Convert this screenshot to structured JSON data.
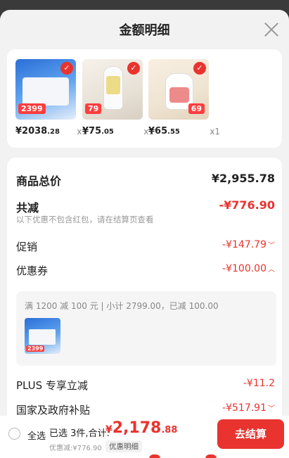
{
  "sheet": {
    "title": "金额明细"
  },
  "products": [
    {
      "price_int": "¥2038",
      "price_dec": ".28",
      "qty": "x1",
      "badge": "2399"
    },
    {
      "price_int": "¥75",
      "price_dec": ".05",
      "qty": "x1",
      "badge": "79"
    },
    {
      "price_int": "¥65",
      "price_dec": ".55",
      "qty": "x1",
      "badge": "69"
    }
  ],
  "summary": {
    "total_label": "商品总价",
    "total_value": "¥2,955.78",
    "reduce_label": "共减",
    "reduce_value": "-¥776.90",
    "reduce_note": "以下优惠不包含红包，请在结算页查看",
    "promo_label": "促销",
    "promo_value": "-¥147.79",
    "coupon_label": "优惠券",
    "coupon_value": "-¥100.00",
    "coupon_detail": "满 1200 减 100 元 | 小计 2799.00，已减 100.00",
    "coupon_thumb_badge": "2399",
    "plus_label": "PLUS 专享立减",
    "plus_value": "-¥11.2",
    "subsidy_label": "国家及政府补贴",
    "subsidy_value": "-¥517.91"
  },
  "footer": {
    "select_all": "全选",
    "selected_summary": "已选 3件,合计:",
    "total_currency": "¥",
    "total_int": "2,178",
    "total_dec": ".88",
    "discount_line": "优惠减:¥776.90",
    "detail_link": "优惠明细",
    "checkout": "去结算"
  },
  "colors": {
    "accent": "#e8332e",
    "sheet_bg": "#f2f2f2",
    "card_bg": "#ffffff"
  }
}
